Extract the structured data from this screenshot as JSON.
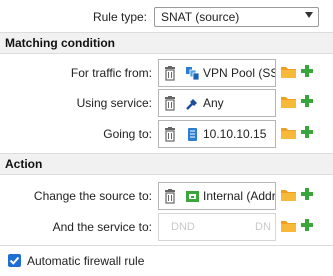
{
  "rule_type": {
    "label": "Rule type:",
    "value": "SNAT (source)"
  },
  "matching": {
    "title": "Matching condition",
    "rows": [
      {
        "label": "For traffic from:",
        "value": "VPN Pool (SS",
        "icon": "network-pool-icon"
      },
      {
        "label": "Using service:",
        "value": "Any",
        "icon": "any-service-icon"
      },
      {
        "label": "Going to:",
        "value": "10.10.10.15",
        "icon": "server-icon"
      }
    ]
  },
  "action": {
    "title": "Action",
    "rows": [
      {
        "label": "Change the source to:",
        "value": "Internal (Addr",
        "icon": "network-icon"
      },
      {
        "label": "And the service to:",
        "placeholder_left": "DND",
        "placeholder_right": "DN"
      }
    ]
  },
  "auto_rule": {
    "label": "Automatic firewall rule",
    "checked": true
  },
  "colors": {
    "accent": "#1f6fd2",
    "plus": "#3aa53a",
    "folder": "#f0a020"
  }
}
